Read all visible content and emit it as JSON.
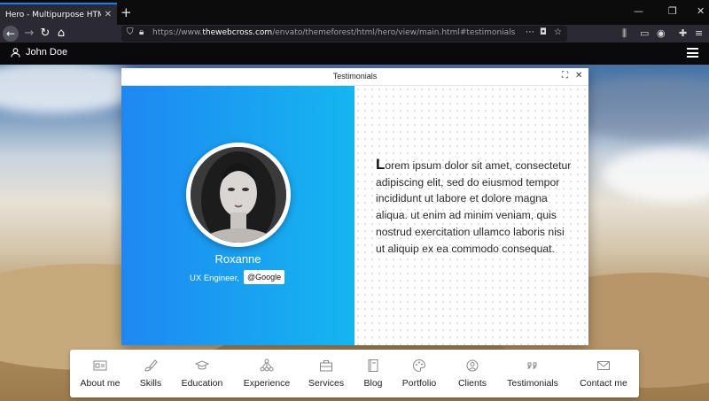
{
  "browser": {
    "tab_title": "Hero - Multipurpose HTML template",
    "url_prefix": "https://www.",
    "url_domain": "thewebcross.com",
    "url_rest": "/envato/themeforest/html/hero/view/main.html#testimonials"
  },
  "header": {
    "user_name": "John Doe"
  },
  "modal": {
    "title": "Testimonials",
    "person": {
      "name": "Roxanne",
      "role": "UX Engineer,",
      "company": "@Google"
    },
    "quote_first_letter": "L",
    "quote_rest": "orem ipsum dolor sit amet, consectetur adipiscing elit, sed do eiusmod tempor incididunt ut labore et dolore magna aliqua. ut enim ad minim veniam, quis nostrud exercitation ullamco laboris nisi ut aliquip ex ea commodo consequat."
  },
  "menu": {
    "items": [
      {
        "label": "About me",
        "icon": "id-card-icon"
      },
      {
        "label": "Skills",
        "icon": "brush-icon"
      },
      {
        "label": "Education",
        "icon": "graduation-cap-icon"
      },
      {
        "label": "Experience",
        "icon": "hierarchy-icon"
      },
      {
        "label": "Services",
        "icon": "briefcase-icon"
      },
      {
        "label": "Blog",
        "icon": "notebook-icon"
      },
      {
        "label": "Portfolio",
        "icon": "palette-icon"
      },
      {
        "label": "Clients",
        "icon": "handshake-icon"
      },
      {
        "label": "Testimonials",
        "icon": "quote-icon"
      },
      {
        "label": "Contact me",
        "icon": "envelope-icon"
      }
    ]
  },
  "colors": {
    "accent_start": "#1e88f2",
    "accent_end": "#15b6f0",
    "browser_chrome": "#2b2a33"
  }
}
